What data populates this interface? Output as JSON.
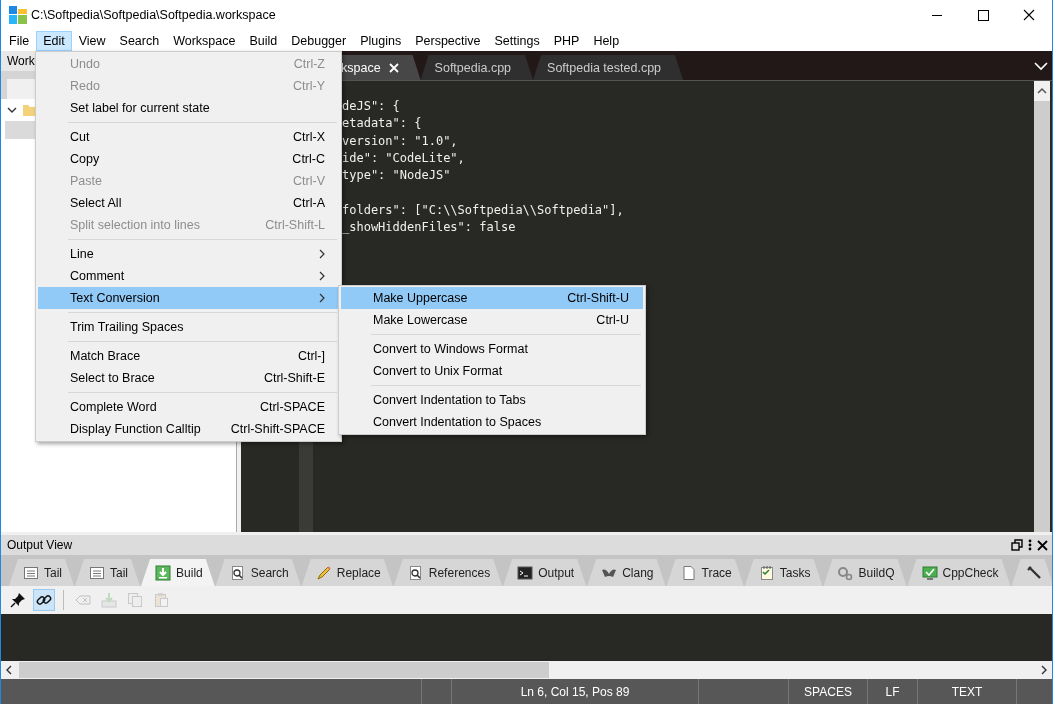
{
  "window": {
    "title": "C:\\Softpedia\\Softpedia\\Softpedia.workspace"
  },
  "menu_bar": [
    {
      "label": "File",
      "selected": false
    },
    {
      "label": "Edit",
      "selected": true
    },
    {
      "label": "View",
      "selected": false
    },
    {
      "label": "Search",
      "selected": false
    },
    {
      "label": "Workspace",
      "selected": false
    },
    {
      "label": "Build",
      "selected": false
    },
    {
      "label": "Debugger",
      "selected": false
    },
    {
      "label": "Plugins",
      "selected": false
    },
    {
      "label": "Perspective",
      "selected": false
    },
    {
      "label": "Settings",
      "selected": false
    },
    {
      "label": "PHP",
      "selected": false
    },
    {
      "label": "Help",
      "selected": false
    }
  ],
  "workspace_panel": {
    "title": "Work"
  },
  "editor": {
    "tabs": [
      {
        "label": "kspace",
        "selected": true,
        "closable": true
      },
      {
        "label": "Softpedia.cpp",
        "selected": false,
        "closable": false
      },
      {
        "label": "Softpedia tested.cpp",
        "selected": false,
        "closable": false
      }
    ],
    "lines": [
      {
        "text": "deJS\": {",
        "gap_before": false
      },
      {
        "text": "etadata\": {",
        "gap_before": false
      },
      {
        "text": "version\": \"1.0\",",
        "gap_before": false
      },
      {
        "text": "ide\": \"CodeLite\",",
        "gap_before": false
      },
      {
        "text": "type\": \"NodeJS\"",
        "gap_before": false
      },
      {
        "text": "folders\": [\"C:\\\\Softpedia\\\\Softpedia\"],",
        "gap_before": true
      },
      {
        "text": "_showHiddenFiles\": false",
        "gap_before": false
      }
    ]
  },
  "edit_menu": [
    {
      "kind": "item",
      "label": "Undo",
      "shortcut": "Ctrl-Z",
      "disabled": true,
      "selected": false
    },
    {
      "kind": "item",
      "label": "Redo",
      "shortcut": "Ctrl-Y",
      "disabled": true,
      "selected": false
    },
    {
      "kind": "item",
      "label": "Set label for current state",
      "disabled": false,
      "selected": false
    },
    {
      "kind": "separator"
    },
    {
      "kind": "item",
      "label": "Cut",
      "shortcut": "Ctrl-X",
      "disabled": false,
      "selected": false
    },
    {
      "kind": "item",
      "label": "Copy",
      "shortcut": "Ctrl-C",
      "disabled": false,
      "selected": false
    },
    {
      "kind": "item",
      "label": "Paste",
      "shortcut": "Ctrl-V",
      "disabled": true,
      "selected": false
    },
    {
      "kind": "item",
      "label": "Select All",
      "shortcut": "Ctrl-A",
      "disabled": false,
      "selected": false
    },
    {
      "kind": "item",
      "label": "Split selection into lines",
      "shortcut": "Ctrl-Shift-L",
      "disabled": true,
      "selected": false
    },
    {
      "kind": "separator"
    },
    {
      "kind": "submenu",
      "label": "Line",
      "disabled": false,
      "selected": false
    },
    {
      "kind": "submenu",
      "label": "Comment",
      "disabled": false,
      "selected": false
    },
    {
      "kind": "submenu",
      "label": "Text Conversion",
      "disabled": false,
      "selected": true
    },
    {
      "kind": "separator"
    },
    {
      "kind": "item",
      "label": "Trim Trailing Spaces",
      "disabled": false,
      "selected": false
    },
    {
      "kind": "separator"
    },
    {
      "kind": "item",
      "label": "Match Brace",
      "shortcut": "Ctrl-]",
      "disabled": false,
      "selected": false
    },
    {
      "kind": "item",
      "label": "Select to Brace",
      "shortcut": "Ctrl-Shift-E",
      "disabled": false,
      "selected": false
    },
    {
      "kind": "separator"
    },
    {
      "kind": "item",
      "label": "Complete Word",
      "shortcut": "Ctrl-SPACE",
      "disabled": false,
      "selected": false
    },
    {
      "kind": "item",
      "label": "Display Function Calltip",
      "shortcut": "Ctrl-Shift-SPACE",
      "disabled": false,
      "selected": false
    }
  ],
  "text_conversion_menu": [
    {
      "kind": "item",
      "label": "Make Uppercase",
      "shortcut": "Ctrl-Shift-U",
      "disabled": false,
      "selected": true
    },
    {
      "kind": "item",
      "label": "Make Lowercase",
      "shortcut": "Ctrl-U",
      "disabled": false,
      "selected": false
    },
    {
      "kind": "separator"
    },
    {
      "kind": "item",
      "label": "Convert to Windows Format",
      "disabled": false,
      "selected": false
    },
    {
      "kind": "item",
      "label": "Convert to Unix Format",
      "disabled": false,
      "selected": false
    },
    {
      "kind": "separator"
    },
    {
      "kind": "item",
      "label": "Convert Indentation to Tabs",
      "disabled": false,
      "selected": false
    },
    {
      "kind": "item",
      "label": "Convert Indentation to Spaces",
      "disabled": false,
      "selected": false
    }
  ],
  "output_view": {
    "title": "Output View",
    "tabs": [
      {
        "label": "Tail",
        "kind": "lines",
        "selected": false
      },
      {
        "label": "Tail",
        "kind": "lines",
        "selected": false
      },
      {
        "label": "Build",
        "kind": "build",
        "selected": true
      },
      {
        "label": "Search",
        "kind": "find",
        "selected": false
      },
      {
        "label": "Replace",
        "kind": "pencil",
        "selected": false
      },
      {
        "label": "References",
        "kind": "find",
        "selected": false
      },
      {
        "label": "Output",
        "kind": "terminal",
        "selected": false
      },
      {
        "label": "Clang",
        "kind": "wing",
        "selected": false
      },
      {
        "label": "Trace",
        "kind": "page",
        "selected": false
      },
      {
        "label": "Tasks",
        "kind": "notepad",
        "selected": false
      },
      {
        "label": "BuildQ",
        "kind": "gears",
        "selected": false
      },
      {
        "label": "CppCheck",
        "kind": "monitor",
        "selected": false
      },
      {
        "kind": "wrench",
        "selected": false
      }
    ],
    "toolbar": [
      {
        "kind": "pin",
        "pressed": false,
        "disabled": false
      },
      {
        "kind": "link",
        "pressed": true,
        "disabled": false
      },
      {
        "kind": "clear",
        "pressed": false,
        "disabled": true
      },
      {
        "kind": "save",
        "pressed": false,
        "disabled": true
      },
      {
        "kind": "copy",
        "pressed": false,
        "disabled": true
      },
      {
        "kind": "paste",
        "pressed": false,
        "disabled": true
      }
    ]
  },
  "status_bar": {
    "position": "Ln 6, Col 15, Pos 89",
    "indentation": "SPACES",
    "line_ending": "LF",
    "mode": "TEXT"
  }
}
